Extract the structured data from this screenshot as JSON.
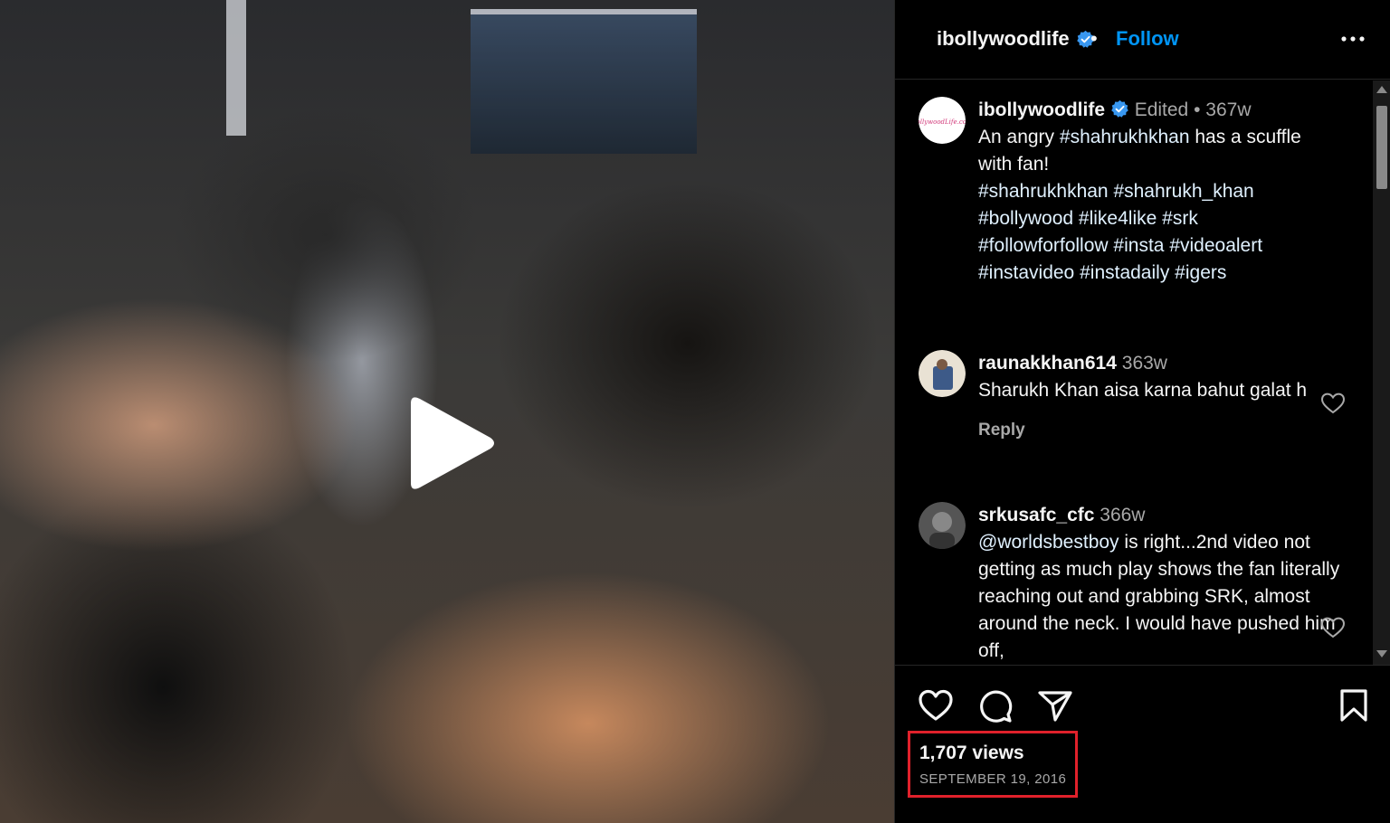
{
  "header": {
    "username": "ibollywoodlife",
    "separator": "•",
    "follow_label": "Follow",
    "more_icon": "more-horizontal-icon"
  },
  "caption": {
    "username": "ibollywoodlife",
    "edited_label": "Edited",
    "separator": "•",
    "age": "367w",
    "text_intro": "An angry ",
    "text_tag": "#shahrukhkhan",
    "text_rest": " has a scuffle with fan!",
    "hashtags": [
      "#shahrukhkhan",
      "#shahrukh_khan",
      "#bollywood",
      "#like4like",
      "#srk",
      "#followforfollow",
      "#insta",
      "#videoalert",
      "#instavideo",
      "#instadaily",
      "#igers"
    ]
  },
  "comments": [
    {
      "username": "raunakkhan614",
      "age": "363w",
      "text": "Sharukh Khan aisa karna bahut galat h",
      "reply_label": "Reply"
    },
    {
      "username": "srkusafc_cfc",
      "age": "366w",
      "mention": "@worldsbestboy",
      "text": " is right...2nd video not getting as much play shows the fan literally reaching out and grabbing SRK, almost around the neck. I would have pushed him off,"
    }
  ],
  "footer": {
    "views": "1,707 views",
    "date": "SEPTEMBER 19, 2016"
  },
  "colors": {
    "accent_blue": "#0095f6",
    "verified_blue": "#3897f0",
    "highlight_red": "#e0212b",
    "background": "#000000",
    "secondary_text": "#a8a8a8"
  }
}
